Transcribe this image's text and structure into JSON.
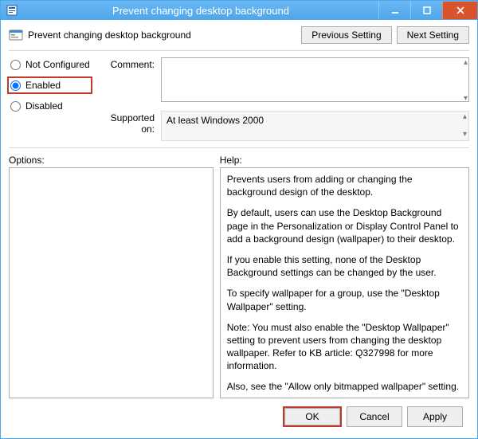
{
  "window": {
    "title": "Prevent changing desktop background"
  },
  "header": {
    "policy_name": "Prevent changing desktop background",
    "prev_btn": "Previous Setting",
    "next_btn": "Next Setting"
  },
  "radios": {
    "not_configured": "Not Configured",
    "enabled": "Enabled",
    "disabled": "Disabled",
    "selected": "enabled"
  },
  "fields": {
    "comment_label": "Comment:",
    "comment_value": "",
    "supported_label": "Supported on:",
    "supported_value": "At least Windows 2000"
  },
  "sections": {
    "options_label": "Options:",
    "help_label": "Help:"
  },
  "help": {
    "p1": "Prevents users from adding or changing the background design of the desktop.",
    "p2": "By default, users can use the Desktop Background page in the Personalization or Display Control Panel to add a background design (wallpaper) to their desktop.",
    "p3": "If you enable this setting, none of the Desktop Background settings can be changed by the user.",
    "p4": "To specify wallpaper for a group, use the \"Desktop Wallpaper\" setting.",
    "p5": "Note: You must also enable the \"Desktop Wallpaper\" setting to prevent users from changing the desktop wallpaper. Refer to KB article: Q327998 for more information.",
    "p6": "Also, see the \"Allow only bitmapped wallpaper\" setting."
  },
  "footer": {
    "ok": "OK",
    "cancel": "Cancel",
    "apply": "Apply"
  }
}
